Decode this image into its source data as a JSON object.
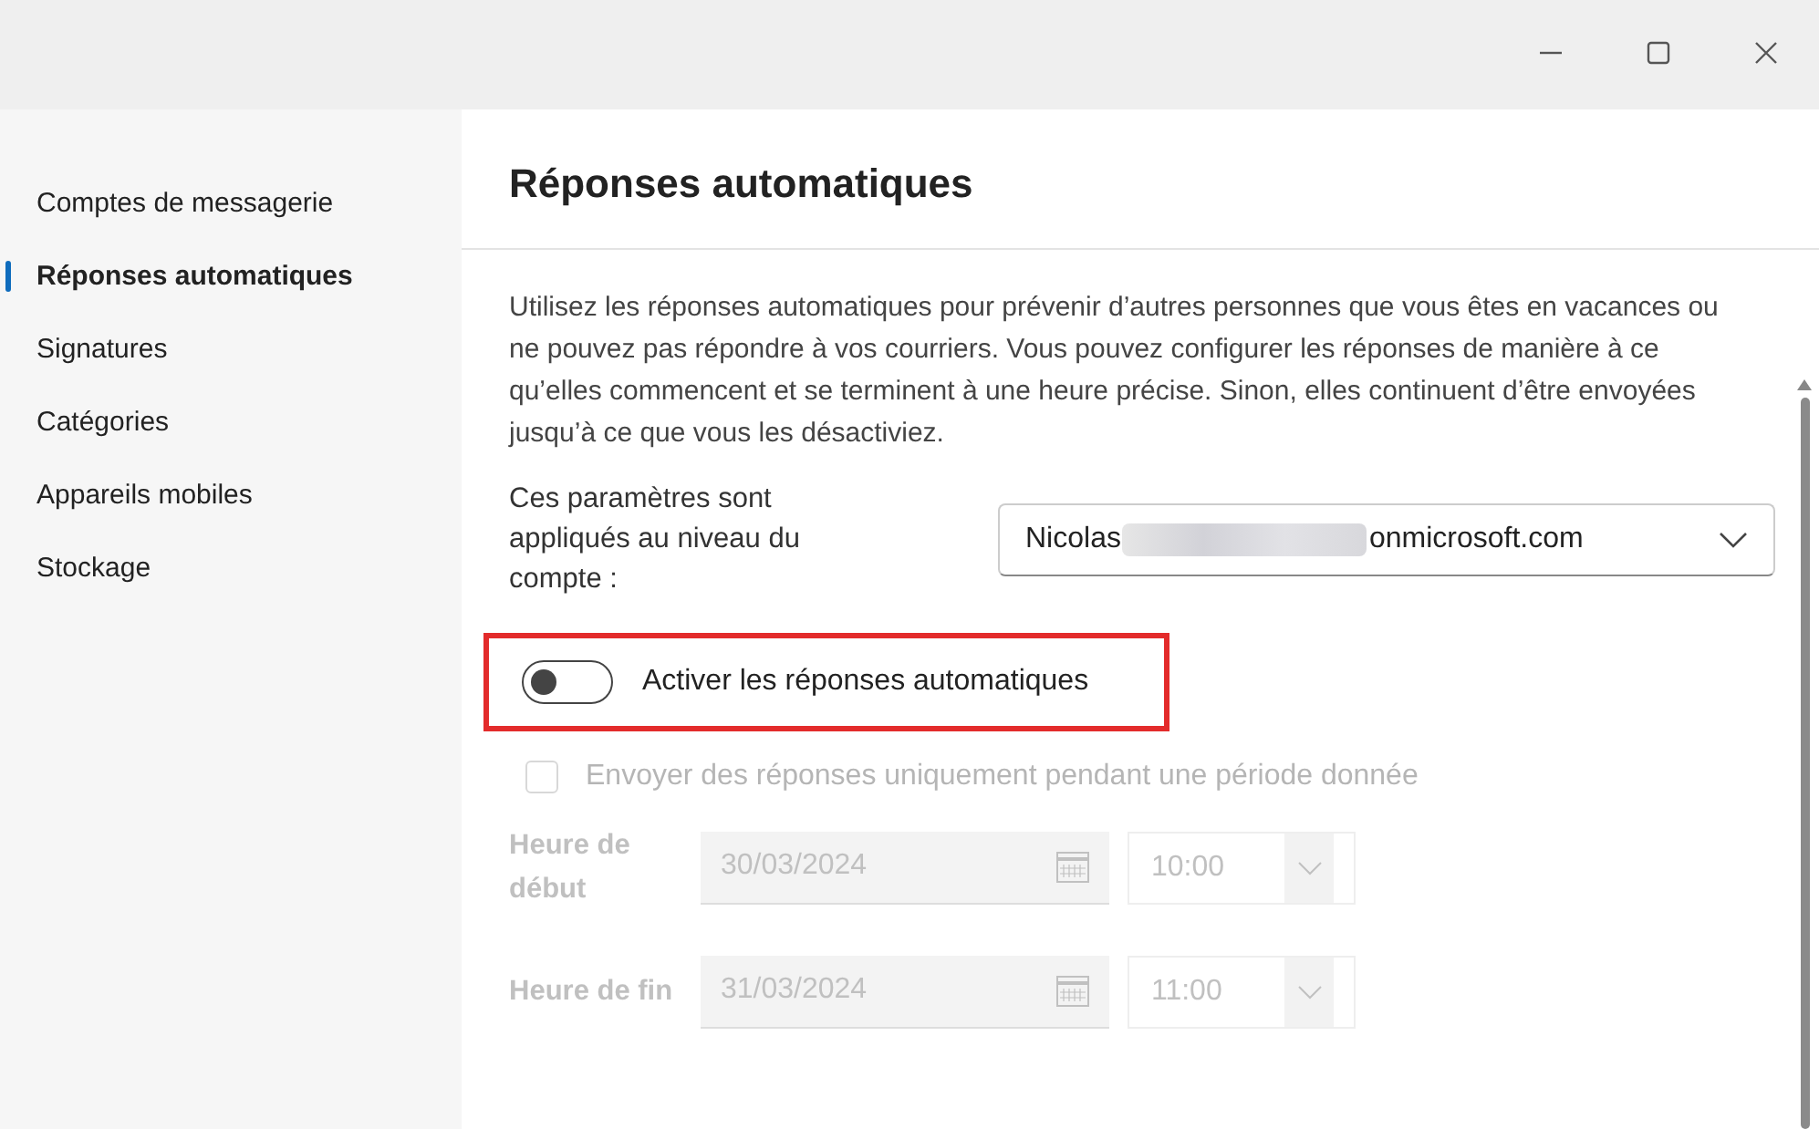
{
  "sidebar": {
    "items": [
      {
        "label": "Comptes de messagerie",
        "selected": false
      },
      {
        "label": "Réponses automatiques",
        "selected": true
      },
      {
        "label": "Signatures",
        "selected": false
      },
      {
        "label": "Catégories",
        "selected": false
      },
      {
        "label": "Appareils mobiles",
        "selected": false
      },
      {
        "label": "Stockage",
        "selected": false
      }
    ]
  },
  "page": {
    "title": "Réponses automatiques",
    "description": "Utilisez les réponses automatiques pour prévenir d’autres personnes que vous êtes en vacances ou ne pouvez pas répondre à vos courriers. Vous pouvez configurer les réponses de manière à ce qu’elles commencent et se terminent à une heure précise. Sinon, elles continuent d’être envoyées jusqu’à ce que vous les désactiviez.",
    "account": {
      "label": "Ces paramètres sont appliqués au niveau du compte :",
      "value_start": "Nicolas",
      "value_end": "onmicrosoft.com",
      "redacted": true
    },
    "toggle": {
      "label": "Activer les réponses automatiques",
      "on": false,
      "highlighted": true
    },
    "period": {
      "label": "Envoyer des réponses uniquement pendant une période donnée",
      "checked": false,
      "disabled": true
    },
    "times": [
      {
        "label": "Heure de début",
        "date": "30/03/2024",
        "time": "10:00",
        "disabled": true
      },
      {
        "label": "Heure de fin",
        "date": "31/03/2024",
        "time": "11:00",
        "disabled": true
      }
    ]
  }
}
